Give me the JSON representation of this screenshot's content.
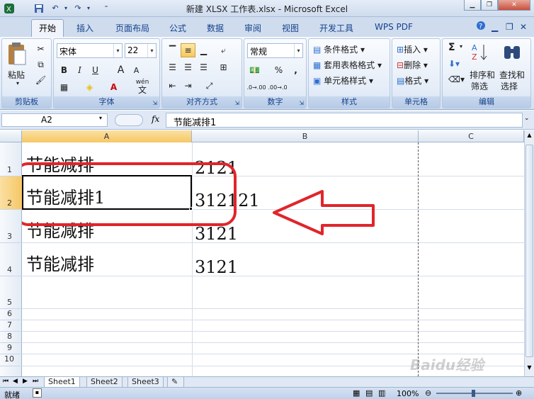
{
  "window": {
    "title": "新建 XLSX 工作表.xlsx - Microsoft Excel"
  },
  "tabs": [
    "开始",
    "插入",
    "页面布局",
    "公式",
    "数据",
    "审阅",
    "视图",
    "开发工具",
    "WPS PDF"
  ],
  "ribbon": {
    "clipboard": {
      "paste_label": "粘贴",
      "group_label": "剪贴板"
    },
    "font": {
      "name": "宋体",
      "size": "22",
      "group_label": "字体",
      "bold": "B",
      "italic": "I",
      "underline": "U",
      "grow": "A",
      "shrink": "A",
      "font_color": "A",
      "wen": "wén",
      "wen_char": "文"
    },
    "alignment": {
      "group_label": "对齐方式"
    },
    "number": {
      "format": "常规",
      "percent": "%",
      "comma": ",",
      "group_label": "数字",
      "inc": ".0→.00",
      "dec": ".00→.0"
    },
    "styles": {
      "conditional": "条件格式",
      "table_format": "套用表格格式",
      "cell_styles": "单元格样式",
      "group_label": "样式"
    },
    "cells": {
      "insert": "插入",
      "delete": "删除",
      "format": "格式",
      "group_label": "单元格"
    },
    "editing": {
      "sort_filter_1": "排序和",
      "sort_filter_2": "筛选",
      "find_select_1": "查找和",
      "find_select_2": "选择",
      "group_label": "编辑",
      "sigma": "Σ"
    }
  },
  "formula_bar": {
    "name_box": "A2",
    "fx": "fx",
    "content": "节能减排1"
  },
  "columns": [
    "A",
    "B",
    "C"
  ],
  "rows": [
    "1",
    "2",
    "3",
    "4",
    "5",
    "6",
    "7",
    "8",
    "9",
    "10"
  ],
  "cells": {
    "A1": "节能减排",
    "B1": "2121",
    "A2": "节能减排1",
    "B2": "312121",
    "A3": "节能减排",
    "B3": "3121",
    "A4": "节能减排",
    "B4": "3121"
  },
  "sheets": [
    "Sheet1",
    "Sheet2",
    "Sheet3"
  ],
  "status": {
    "ready": "就绪",
    "zoom": "100%"
  },
  "watermark": "Baidu经验 jingyan.baidu.com",
  "colors": {
    "annotation": "#e0252b",
    "selection": "#f6c765",
    "ribbon": "#dbe6f4"
  }
}
